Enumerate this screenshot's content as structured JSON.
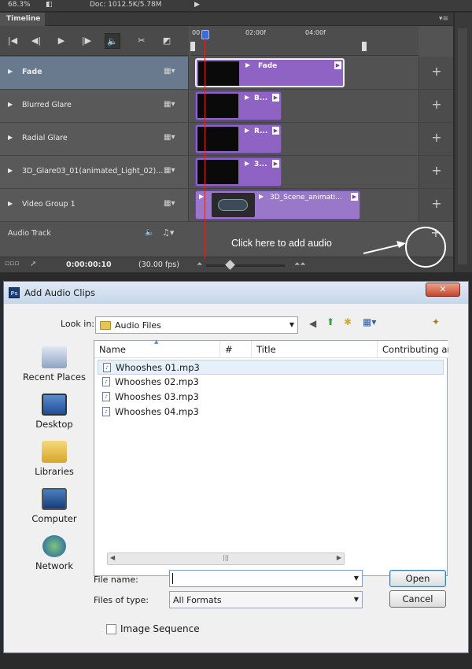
{
  "ps_status": {
    "zoom": "68.3%",
    "doc": "Doc: 1012.5K/5.78M"
  },
  "timeline": {
    "tab_label": "Timeline",
    "ruler": {
      "start": "00",
      "mark1": "02:00f",
      "mark2": "04:00f"
    },
    "tracks": [
      {
        "name": "Fade",
        "clip_label": "Fade"
      },
      {
        "name": "Blurred Glare",
        "clip_label": "B..."
      },
      {
        "name": "Radial Glare",
        "clip_label": "R..."
      },
      {
        "name": "3D_Glare03_01(animated_Light_02)...",
        "clip_label": "3..."
      },
      {
        "name": "Video Group 1",
        "clip_label": "3D_Scene_animati..."
      }
    ],
    "audio_track_label": "Audio Track",
    "timecode": "0:00:00:10",
    "fps": "(30.00 fps)",
    "hint": "Click here to add audio"
  },
  "dialog": {
    "title": "Add Audio Clips",
    "look_in_label": "Look in:",
    "look_in_value": "Audio Files",
    "places": [
      "Recent Places",
      "Desktop",
      "Libraries",
      "Computer",
      "Network"
    ],
    "columns": [
      "Name",
      "#",
      "Title",
      "Contributing art"
    ],
    "files": [
      "Whooshes 01.mp3",
      "Whooshes 02.mp3",
      "Whooshes 03.mp3",
      "Whooshes 04.mp3"
    ],
    "file_name_label": "File name:",
    "file_name_value": "",
    "files_of_type_label": "Files of type:",
    "files_of_type_value": "All Formats",
    "open_button": "Open",
    "cancel_button": "Cancel",
    "image_sequence_label": "Image Sequence"
  },
  "colors": {
    "clip_purple": "#8e63c4",
    "playhead_red": "#d42626",
    "dialog_bg": "#f0f0f0"
  }
}
